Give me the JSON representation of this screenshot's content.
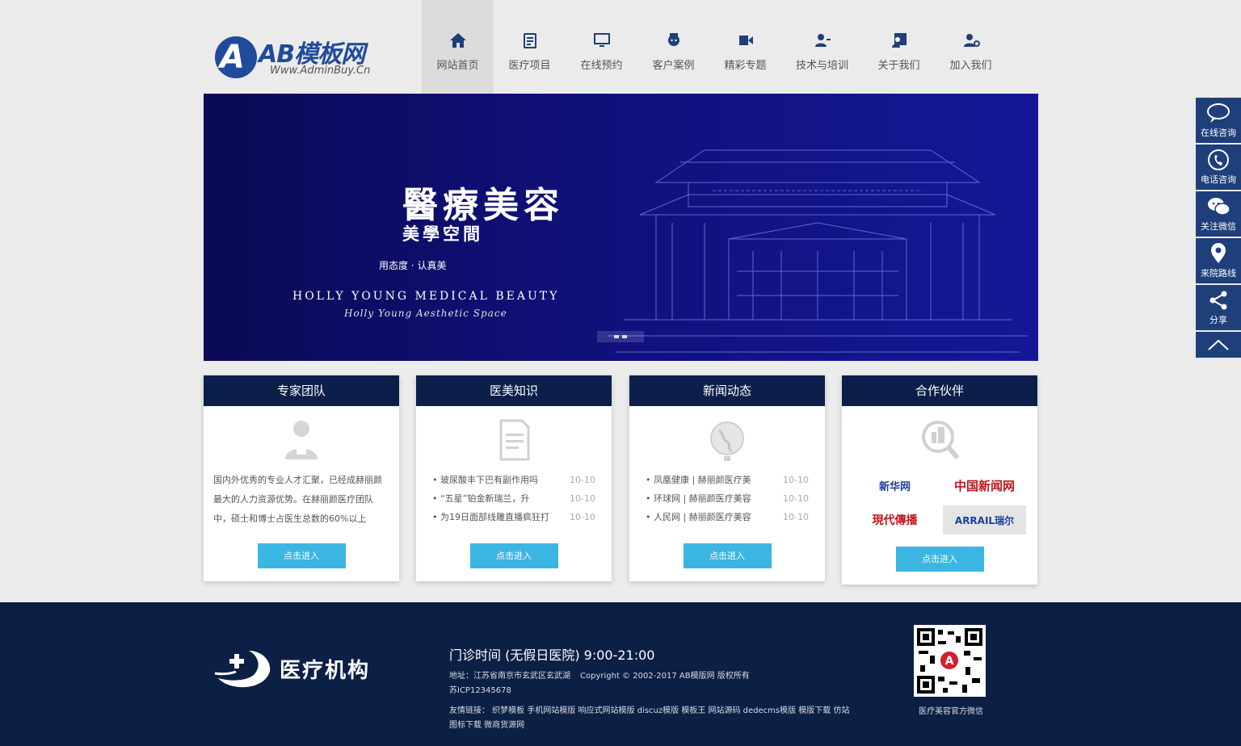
{
  "logo": {
    "title": "AB模板网",
    "subtitle": "Www.AdminBuy.Cn"
  },
  "nav": {
    "items": [
      {
        "label": "网站首页",
        "icon": "home-icon"
      },
      {
        "label": "医疗项目",
        "icon": "clipboard-icon"
      },
      {
        "label": "在线预约",
        "icon": "monitor-icon"
      },
      {
        "label": "客户案例",
        "icon": "nurse-icon"
      },
      {
        "label": "精彩专题",
        "icon": "video-icon"
      },
      {
        "label": "技术与培训",
        "icon": "user-training-icon"
      },
      {
        "label": "关于我们",
        "icon": "user-card-icon"
      },
      {
        "label": "加入我们",
        "icon": "user-add-icon"
      }
    ]
  },
  "banner": {
    "title": "醫療美容",
    "subtitle": "美學空間",
    "slogan": "用态度 · 认真美",
    "english": "HOLLY YOUNG MEDICAL BEAUTY",
    "english_sub": "Holly Young Aesthetic Space"
  },
  "cards": {
    "experts": {
      "title": "专家团队",
      "text": "国内外优秀的专业人才汇聚，已经成赫丽颜最大的人力资源优势。在赫丽颜医疗团队中，硕士和博士占医生总数的60%以上",
      "button": "点击进入"
    },
    "knowledge": {
      "title": "医美知识",
      "items": [
        {
          "text": "• 玻尿酸丰下巴有副作用吗",
          "date": "10-10"
        },
        {
          "text": "• “五星”铂金新瑞兰，升",
          "date": "10-10"
        },
        {
          "text": "• 为19日面部线雕直播疯狂打",
          "date": "10-10"
        }
      ],
      "button": "点击进入"
    },
    "news": {
      "title": "新闻动态",
      "items": [
        {
          "text": "• 凤凰健康 | 赫丽颜医疗美",
          "date": "10-10"
        },
        {
          "text": "• 环球网 | 赫丽颜医疗美容",
          "date": "10-10"
        },
        {
          "text": "• 人民网 | 赫丽颜医疗美容",
          "date": "10-10"
        }
      ],
      "button": "点击进入"
    },
    "partners": {
      "title": "合作伙伴",
      "logos": [
        "新华网",
        "中国新闻网",
        "現代傳播",
        "ARRAIL瑞尔"
      ],
      "button": "点击进入"
    }
  },
  "footer": {
    "logo_text": "医疗机构",
    "hours": "门诊时间 (无假日医院) 9:00-21:00",
    "address": "地址：江苏省南京市玄武区玄武湖",
    "copyright": "Copyright © 2002-2017 AB模版网 版权所有",
    "icp": "苏ICP12345678",
    "links": "友情链接： 织梦模板 手机网站模版 响应式网站模版 discuz模版 模板王 网站源码 dedecms模版 模版下载 仿站 图标下载 微商货源网",
    "qr_label": "医疗美容官方微信"
  },
  "side": {
    "items": [
      {
        "label": "在线咨询",
        "icon": "chat-icon"
      },
      {
        "label": "电话咨询",
        "icon": "phone-icon"
      },
      {
        "label": "关注微信",
        "icon": "wechat-icon"
      },
      {
        "label": "来院路线",
        "icon": "location-icon"
      },
      {
        "label": "分享",
        "icon": "share-icon"
      }
    ]
  },
  "colors": {
    "navy": "#0c1f4a",
    "button": "#3bb6e2",
    "side": "#1f3f7a",
    "banner": "#10107a"
  }
}
